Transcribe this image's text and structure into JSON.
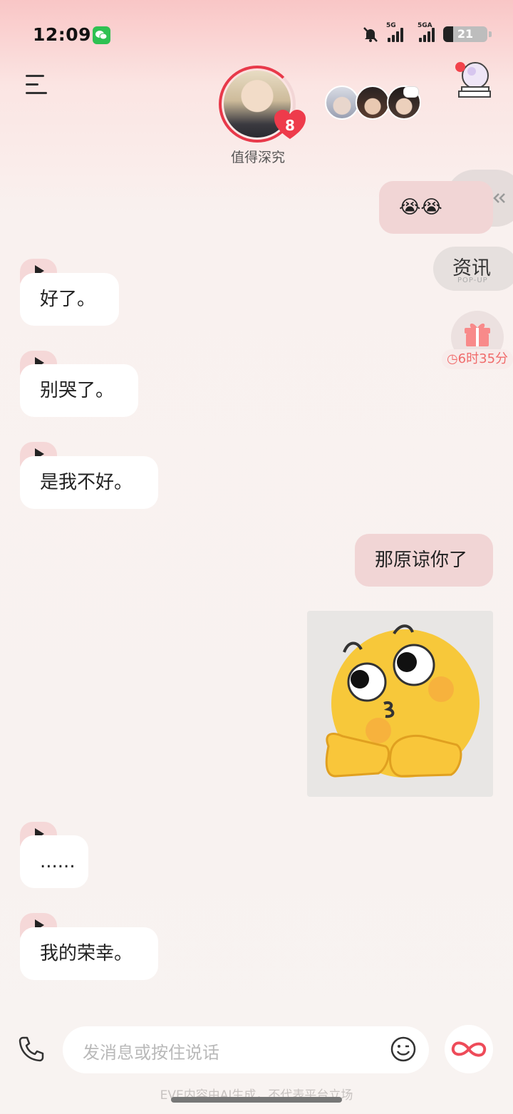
{
  "status_bar": {
    "time": "12:09",
    "signal_1_label": "5G",
    "signal_2_label": "5GA",
    "battery": "21",
    "icons": [
      "wechat-icon",
      "mute-bell-icon",
      "signal-icon",
      "battery-icon"
    ]
  },
  "header": {
    "character_name": "值得深究",
    "heart_count": "8",
    "icons": [
      "menu-icon",
      "crystal-ball-icon"
    ]
  },
  "side_widgets": {
    "news_title": "资讯",
    "news_sub": "POP-UP",
    "gift_timer": "6时35分",
    "icons": [
      "report-icon",
      "gift-icon"
    ]
  },
  "messages": [
    {
      "sender": "me",
      "text": "😭😭"
    },
    {
      "sender": "ai",
      "text": "好了。",
      "voice": true
    },
    {
      "sender": "ai",
      "text": "别哭了。",
      "voice": true
    },
    {
      "sender": "ai",
      "text": "是我不好。",
      "voice": true
    },
    {
      "sender": "me",
      "text": "那原谅你了"
    },
    {
      "sender": "me",
      "type": "sticker",
      "icon": "emoji-sticker"
    },
    {
      "sender": "ai",
      "text": "......",
      "voice": true
    },
    {
      "sender": "ai",
      "text": "我的荣幸。",
      "voice": true
    }
  ],
  "input": {
    "placeholder": "发消息或按住说话"
  },
  "footer": {
    "disclaimer": "EVE内容由AI生成，不代表平台立场"
  },
  "colors": {
    "accent_red": "#e8394a",
    "my_bubble": "#f1d5d5",
    "ai_bubble": "#ffffff",
    "play_tab": "#f5d8d8",
    "timer_text": "#f06b6b"
  }
}
